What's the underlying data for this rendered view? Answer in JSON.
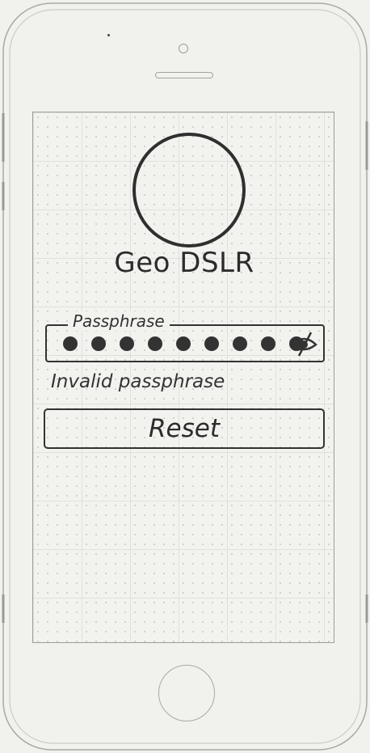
{
  "app": {
    "title": "Geo DSLR"
  },
  "passphrase": {
    "label": "Passphrase",
    "masked_dot_count": 9,
    "visibility_icon": "eye-slash-icon"
  },
  "error": {
    "message": "Invalid passphrase"
  },
  "actions": {
    "reset_label": "Reset"
  },
  "colors": {
    "ink": "#333333",
    "paper": "#f2f2ef",
    "outline": "#9d9d98"
  }
}
